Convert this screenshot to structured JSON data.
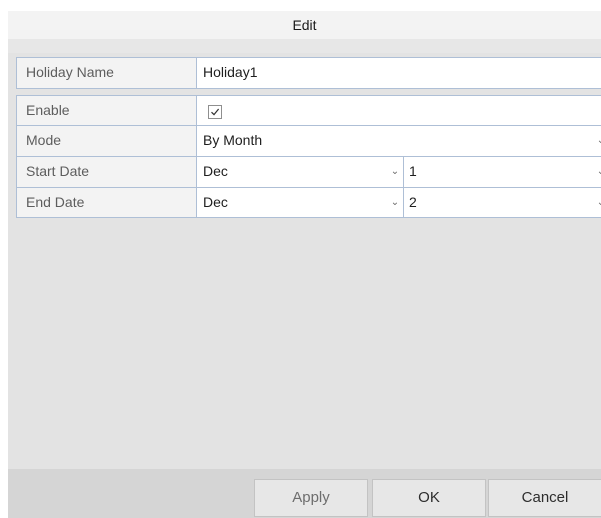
{
  "dialog": {
    "title": "Edit"
  },
  "form": {
    "holiday_name": {
      "label": "Holiday Name",
      "value": "Holiday1"
    },
    "enable": {
      "label": "Enable",
      "checked": true
    },
    "mode": {
      "label": "Mode",
      "value": "By Month"
    },
    "start_date": {
      "label": "Start Date",
      "month": "Dec",
      "day": "1"
    },
    "end_date": {
      "label": "End Date",
      "month": "Dec",
      "day": "2"
    }
  },
  "buttons": {
    "apply": "Apply",
    "ok": "OK",
    "cancel": "Cancel"
  },
  "icons": {
    "dropdown": "chevron-down-icon",
    "check": "checkmark-icon"
  }
}
